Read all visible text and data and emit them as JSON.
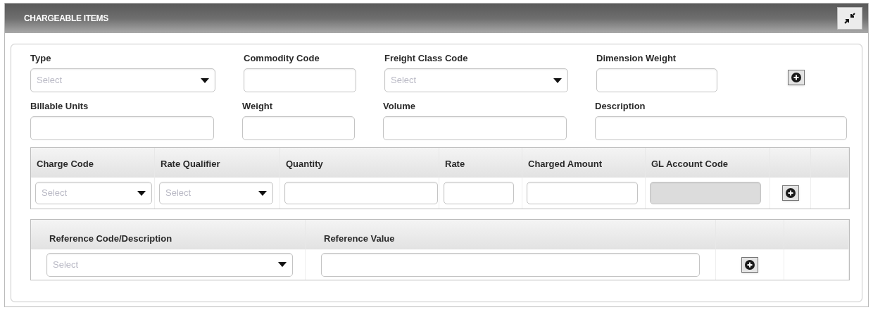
{
  "panel": {
    "title": "CHARGEABLE ITEMS"
  },
  "field_rows": [
    [
      {
        "label": "Type",
        "kind": "select",
        "placeholder": "Select"
      },
      {
        "label": "Commodity Code",
        "kind": "text"
      },
      {
        "label": "Freight Class Code",
        "kind": "select",
        "placeholder": "Select"
      },
      {
        "label": "Dimension Weight",
        "kind": "text"
      },
      {
        "kind": "add"
      }
    ],
    [
      {
        "label": "Billable Units",
        "kind": "text"
      },
      {
        "label": "Weight",
        "kind": "text"
      },
      {
        "label": "Volume",
        "kind": "text"
      },
      {
        "label": "Description",
        "kind": "text"
      }
    ]
  ],
  "charges_table": {
    "columns": [
      "Charge Code",
      "Rate Qualifier",
      "Quantity",
      "Rate",
      "Charged Amount",
      "GL Account Code"
    ],
    "row": [
      {
        "kind": "select",
        "placeholder": "Select"
      },
      {
        "kind": "select",
        "placeholder": "Select"
      },
      {
        "kind": "text",
        "disabled": false
      },
      {
        "kind": "text",
        "disabled": false
      },
      {
        "kind": "text",
        "disabled": false
      },
      {
        "kind": "text",
        "disabled": true
      },
      {
        "kind": "add"
      }
    ]
  },
  "references_table": {
    "columns": [
      "Reference Code/Description",
      "Reference Value"
    ],
    "row": [
      {
        "kind": "select",
        "placeholder": "Select"
      },
      {
        "kind": "text",
        "disabled": false
      },
      {
        "kind": "add"
      }
    ]
  }
}
